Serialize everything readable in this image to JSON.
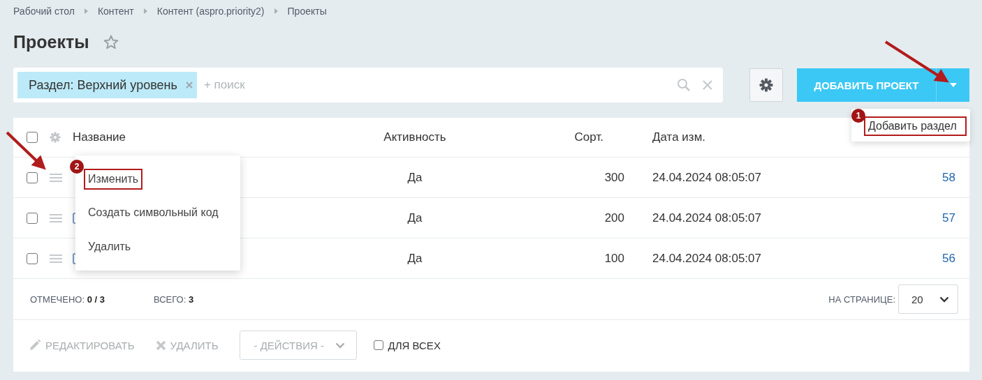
{
  "breadcrumbs": [
    {
      "label": "Рабочий стол"
    },
    {
      "label": "Контент"
    },
    {
      "label": "Контент (aspro.priority2)"
    },
    {
      "label": "Проекты"
    }
  ],
  "title": "Проекты",
  "filter": {
    "tag": "Раздел: Верхний уровень",
    "placeholder": "+ поиск"
  },
  "add_button": {
    "label": "ДОБАВИТЬ ПРОЕКТ",
    "menu": [
      {
        "label": "Добавить раздел",
        "badge": "1",
        "highlighted": true
      }
    ]
  },
  "table": {
    "header_checked": false,
    "columns": [
      "Название",
      "Активность",
      "Сорт.",
      "Дата изм."
    ],
    "rows": [
      {
        "checked": false,
        "active": "Да",
        "sort": "300",
        "date": "24.04.2024 08:05:07",
        "id": "58"
      },
      {
        "checked": false,
        "folder": true,
        "active": "Да",
        "sort": "200",
        "date": "24.04.2024 08:05:07",
        "id": "57"
      },
      {
        "checked": false,
        "folder": true,
        "active": "Да",
        "sort": "100",
        "date": "24.04.2024 08:05:07",
        "id": "56"
      }
    ]
  },
  "context_menu": [
    {
      "label": "Изменить",
      "badge": "2",
      "highlighted": true
    },
    {
      "label": "Создать символьный код",
      "highlighted": false
    },
    {
      "label": "Удалить",
      "highlighted": false
    }
  ],
  "footer": {
    "marked_label": "ОТМЕЧЕНО:",
    "marked": "0 / 3",
    "total_label": "ВСЕГО:",
    "total": "3",
    "per_page_label": "НА СТРАНИЦЕ:",
    "per_page": "20"
  },
  "actions": {
    "edit": "РЕДАКТИРОВАТЬ",
    "delete": "УДАЛИТЬ",
    "select": "- ДЕЙСТВИЯ -",
    "for_all": "ДЛЯ ВСЕХ",
    "for_all_checked": false
  }
}
